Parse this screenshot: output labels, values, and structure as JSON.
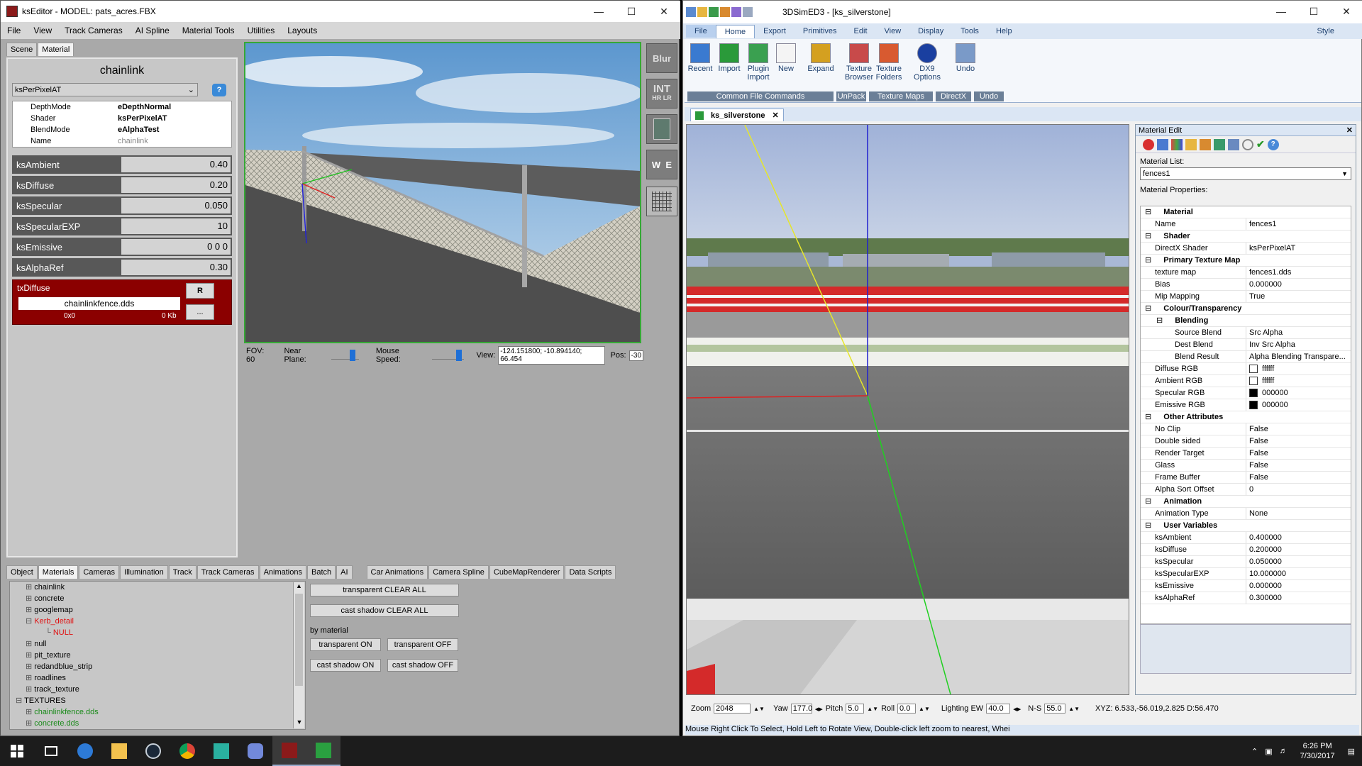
{
  "ks": {
    "title": "ksEditor - MODEL: pats_acres.FBX",
    "menu": [
      "File",
      "View",
      "Track Cameras",
      "AI Spline",
      "Material Tools",
      "Utilities",
      "Layouts"
    ],
    "panel_tabs": [
      "Scene",
      "Material"
    ],
    "material_title": "chainlink",
    "shader_select": "ksPerPixelAT",
    "props": [
      {
        "k": "DepthMode",
        "v": "eDepthNormal"
      },
      {
        "k": "Shader",
        "v": "ksPerPixelAT"
      },
      {
        "k": "BlendMode",
        "v": "eAlphaTest"
      },
      {
        "k": "Name",
        "v": "chainlink"
      }
    ],
    "vars": [
      {
        "k": "ksAmbient",
        "v": "0.40"
      },
      {
        "k": "ksDiffuse",
        "v": "0.20"
      },
      {
        "k": "ksSpecular",
        "v": "0.050"
      },
      {
        "k": "ksSpecularEXP",
        "v": "10"
      },
      {
        "k": "ksEmissive",
        "v": "0 0 0"
      },
      {
        "k": "ksAlphaRef",
        "v": "0.30"
      }
    ],
    "tx": {
      "label": "txDiffuse",
      "file": "chainlinkfence.dds",
      "dims": "0x0",
      "size": "0 Kb",
      "r": "R",
      "more": "..."
    },
    "side_icons": [
      "Blur",
      "INT",
      "HR",
      "LR",
      "W",
      "E"
    ],
    "viewbar": {
      "fov": "FOV: 60",
      "near": "Near Plane:",
      "mouse": "Mouse Speed:",
      "view_label": "View:",
      "view_value": "-124.151800; -10.894140; 66.454",
      "pos_label": "Pos:",
      "pos_value": "-30"
    },
    "bottom_tabs": [
      "Object",
      "Materials",
      "Cameras",
      "Illumination",
      "Track",
      "Track Cameras",
      "Animations",
      "Batch",
      "AI",
      "Car Animations",
      "Camera Spline",
      "CubeMapRenderer",
      "Data Scripts"
    ],
    "tree": [
      {
        "t": "chainlink",
        "c": "#000",
        "i": 1
      },
      {
        "t": "concrete",
        "c": "#000",
        "i": 1
      },
      {
        "t": "googlemap",
        "c": "#000",
        "i": 1
      },
      {
        "t": "Kerb_detail",
        "c": "#e01010",
        "i": 1
      },
      {
        "t": "NULL",
        "c": "#e01010",
        "i": 3
      },
      {
        "t": "null",
        "c": "#000",
        "i": 1
      },
      {
        "t": "pit_texture",
        "c": "#000",
        "i": 1
      },
      {
        "t": "redandblue_strip",
        "c": "#000",
        "i": 1
      },
      {
        "t": "roadlines",
        "c": "#000",
        "i": 1
      },
      {
        "t": "track_texture",
        "c": "#000",
        "i": 1
      },
      {
        "t": "TEXTURES",
        "c": "#000",
        "i": 0
      },
      {
        "t": "chainlinkfence.dds",
        "c": "#1a8a1a",
        "i": 1
      },
      {
        "t": "concrete.dds",
        "c": "#1a8a1a",
        "i": 1
      }
    ],
    "btns": {
      "tclear": "transparent CLEAR ALL",
      "sclear": "cast shadow CLEAR ALL",
      "bymat": "by material",
      "ton": "transparent ON",
      "toff": "transparent OFF",
      "son": "cast shadow ON",
      "soff": "cast shadow OFF"
    }
  },
  "td": {
    "title": "3DSimED3 - [ks_silverstone]",
    "style_label": "Style",
    "ribbon_tabs": [
      "File",
      "Home",
      "Export",
      "Primitives",
      "Edit",
      "View",
      "Display",
      "Tools",
      "Help"
    ],
    "ribbon": [
      {
        "label": "Recent",
        "color": "#3a7ad0"
      },
      {
        "label": "Import",
        "color": "#2a9a3a"
      },
      {
        "label": "Plugin\nImport",
        "color": "#3aa050"
      },
      {
        "label": "New",
        "color": "#f4f4f4"
      },
      {
        "label": "Expand",
        "color": "#d4a020"
      },
      {
        "label": "Texture\nBrowser",
        "color": "#c84a4a"
      },
      {
        "label": "Texture\nFolders",
        "color": "#d85a30"
      },
      {
        "label": "DX9\nOptions",
        "color": "#1a3fa0"
      },
      {
        "label": "Undo",
        "color": "#7a9ac8"
      }
    ],
    "groups": [
      "Common File Commands",
      "UnPack",
      "Texture Maps",
      "DirectX",
      "Undo"
    ],
    "doc_tab": "ks_silverstone",
    "bottom": {
      "zoom_l": "Zoom",
      "zoom": "2048",
      "yaw_l": "Yaw",
      "yaw": "177.0",
      "pitch_l": "Pitch",
      "pitch": "5.0",
      "roll_l": "Roll",
      "roll": "0.0",
      "light_l": "Lighting EW",
      "light": "40.0",
      "ns_l": "N-S",
      "ns": "55.0",
      "xyz": "XYZ: 6.533,-56.019,2.825 D:56.470"
    },
    "status": "Mouse Right Click To Select, Hold Left to Rotate View, Double-click left  zoom to nearest, Whei",
    "medit": {
      "title": "Material Edit",
      "list_label": "Material List:",
      "list_value": "fences1",
      "props_label": "Material Properties:",
      "rows": [
        {
          "t": "sec",
          "k": "Material"
        },
        {
          "t": "row",
          "k": "Name",
          "v": "fences1"
        },
        {
          "t": "sec",
          "k": "Shader"
        },
        {
          "t": "row",
          "k": "DirectX Shader",
          "v": "ksPerPixelAT"
        },
        {
          "t": "sec",
          "k": "Primary Texture Map"
        },
        {
          "t": "row",
          "k": "texture map",
          "v": "fences1.dds"
        },
        {
          "t": "row",
          "k": "Bias",
          "v": "0.000000"
        },
        {
          "t": "row",
          "k": "Mip Mapping",
          "v": "True"
        },
        {
          "t": "sec",
          "k": "Colour/Transparency"
        },
        {
          "t": "sub",
          "k": "Blending"
        },
        {
          "t": "sub2",
          "k": "Source Blend",
          "v": "Src Alpha"
        },
        {
          "t": "sub2",
          "k": "Dest Blend",
          "v": "Inv Src Alpha"
        },
        {
          "t": "sub2",
          "k": "Blend Result",
          "v": "Alpha Blending Transpare..."
        },
        {
          "t": "row",
          "k": "Diffuse RGB",
          "v": "ffffff",
          "sw": "#ffffff"
        },
        {
          "t": "row",
          "k": "Ambient RGB",
          "v": "ffffff",
          "sw": "#ffffff"
        },
        {
          "t": "row",
          "k": "Specular RGB",
          "v": "000000",
          "sw": "#000000"
        },
        {
          "t": "row",
          "k": "Emissive RGB",
          "v": "000000",
          "sw": "#000000"
        },
        {
          "t": "sec",
          "k": "Other Attributes"
        },
        {
          "t": "row",
          "k": "No Clip",
          "v": "False"
        },
        {
          "t": "row",
          "k": "Double sided",
          "v": "False"
        },
        {
          "t": "row",
          "k": "Render Target",
          "v": "False"
        },
        {
          "t": "row",
          "k": "Glass",
          "v": "False"
        },
        {
          "t": "row",
          "k": "Frame Buffer",
          "v": "False"
        },
        {
          "t": "row",
          "k": "Alpha Sort Offset",
          "v": "0"
        },
        {
          "t": "sec",
          "k": "Animation"
        },
        {
          "t": "row",
          "k": "Animation Type",
          "v": "None"
        },
        {
          "t": "sec",
          "k": "User Variables"
        },
        {
          "t": "row",
          "k": "ksAmbient",
          "v": "0.400000"
        },
        {
          "t": "row",
          "k": "ksDiffuse",
          "v": "0.200000"
        },
        {
          "t": "row",
          "k": "ksSpecular",
          "v": "0.050000"
        },
        {
          "t": "row",
          "k": "ksSpecularEXP",
          "v": "10.000000"
        },
        {
          "t": "row",
          "k": "ksEmissive",
          "v": "0.000000"
        },
        {
          "t": "row",
          "k": "ksAlphaRef",
          "v": "0.300000"
        }
      ]
    }
  },
  "taskbar": {
    "time": "6:26 PM",
    "date": "7/30/2017"
  }
}
